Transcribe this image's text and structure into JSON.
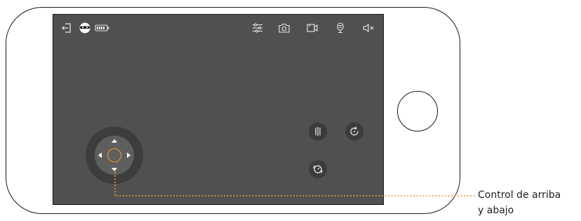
{
  "device": {
    "type": "phone-landscape-outline",
    "frame_color": "#1a1a1a",
    "screen_color": "#505050"
  },
  "topbar": {
    "icons": [
      {
        "name": "exit-icon",
        "glyph": "exit"
      },
      {
        "name": "robot-avatar-icon",
        "glyph": "robot"
      },
      {
        "name": "battery-icon",
        "glyph": "battery"
      },
      {
        "name": "settings-sliders-icon",
        "glyph": "sliders"
      },
      {
        "name": "camera-icon",
        "glyph": "camera"
      },
      {
        "name": "video-record-icon",
        "glyph": "video"
      },
      {
        "name": "microphone-icon",
        "glyph": "mic"
      },
      {
        "name": "mute-icon",
        "glyph": "mute"
      }
    ]
  },
  "joystick": {
    "accent_color": "#f29a2e",
    "directions": [
      "up",
      "down",
      "left",
      "right"
    ]
  },
  "action_buttons": [
    {
      "name": "brush-button",
      "glyph": "brush"
    },
    {
      "name": "rotate-button",
      "glyph": "rotate"
    },
    {
      "name": "spin-button",
      "glyph": "spin"
    }
  ],
  "callout": {
    "line_color": "#f29a2e",
    "line_1": "Control de arriba",
    "line_2": "y abajo"
  }
}
